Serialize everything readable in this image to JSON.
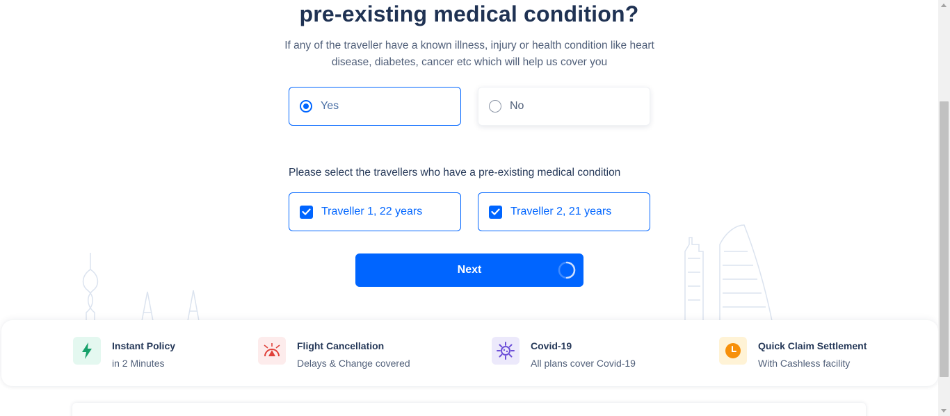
{
  "question": {
    "title": "pre-existing medical condition?",
    "subtitle": "If any of the traveller have a known illness, injury or health condition like heart disease, diabetes, cancer etc which will help us cover you"
  },
  "options": [
    {
      "label": "Yes",
      "selected": true
    },
    {
      "label": "No",
      "selected": false
    }
  ],
  "travellers_section": {
    "label": "Please select the travellers who have a pre-existing medical condition",
    "travellers": [
      {
        "label": "Traveller 1, 22 years",
        "checked": true
      },
      {
        "label": "Traveller 2, 21 years",
        "checked": true
      }
    ]
  },
  "next_button": {
    "label": "Next",
    "loading": true
  },
  "benefits": [
    {
      "icon": "lightning-icon",
      "title": "Instant Policy",
      "subtitle": "in 2 Minutes"
    },
    {
      "icon": "flight-cancellation-icon",
      "title": "Flight Cancellation",
      "subtitle": "Delays & Change covered"
    },
    {
      "icon": "virus-icon",
      "title": "Covid-19",
      "subtitle": "All plans cover Covid-19"
    },
    {
      "icon": "clock-icon",
      "title": "Quick Claim Settlement",
      "subtitle": "With Cashless facility"
    }
  ],
  "colors": {
    "primary": "#0065ff",
    "title": "#1f3253",
    "text": "#505f79"
  }
}
